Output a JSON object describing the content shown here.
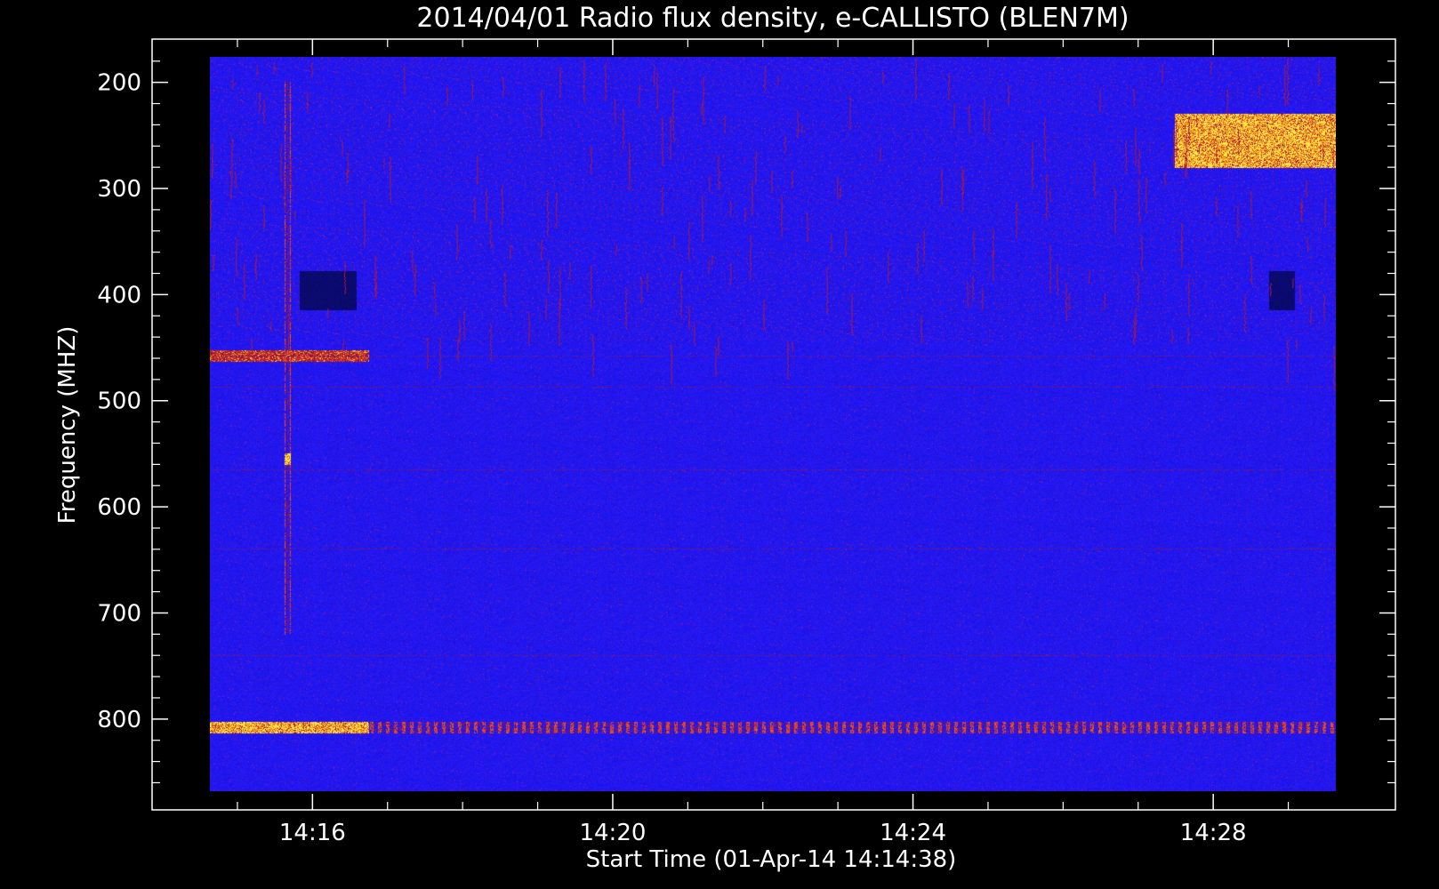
{
  "chart_data": {
    "type": "heatmap",
    "title": "2014/04/01  Radio flux density, e-CALLISTO (BLEN7M)",
    "xlabel": "Start Time (01-Apr-14 14:14:38)",
    "ylabel": "Frequency (MHZ)",
    "x_unit": "time of day (UTC)",
    "x_range": [
      "14:14:38",
      "14:29:38"
    ],
    "y_range": [
      176,
      868
    ],
    "y_inverted": true,
    "x_ticks": [
      "14:16",
      "14:20",
      "14:24",
      "14:28"
    ],
    "y_ticks": [
      200,
      300,
      400,
      500,
      600,
      700,
      800
    ],
    "colormap": "blue-red-yellow",
    "colors": {
      "background_level": "#1a1af0",
      "low_level": "#0a0a80",
      "medium_level": "#c01818",
      "high_level": "#ffe030",
      "frame": "#ffffff",
      "page_background": "#000000"
    },
    "features": [
      {
        "name": "strong emission band",
        "freq_mhz": 808,
        "time_start": "14:14:38",
        "time_end": "14:16:45",
        "level": "high"
      },
      {
        "name": "intermittent band",
        "freq_mhz": 808,
        "time_start": "14:16:45",
        "time_end": "14:29:38",
        "level": "medium"
      },
      {
        "name": "emission band",
        "freq_mhz": 458,
        "time_start": "14:14:38",
        "time_end": "14:16:45",
        "level": "medium-high"
      },
      {
        "name": "vertical burst",
        "freq_mhz_range": [
          200,
          720
        ],
        "time": "14:15:40",
        "level": "medium"
      },
      {
        "name": "bright spot",
        "freq_mhz": 555,
        "time": "14:15:40",
        "level": "high"
      },
      {
        "name": "burst cluster",
        "freq_mhz_range": [
          230,
          280
        ],
        "time_start": "14:27:30",
        "time_end": "14:29:38",
        "level": "high"
      },
      {
        "name": "dark gap",
        "freq_mhz_range": [
          378,
          414
        ],
        "time_start": "14:15:50",
        "time_end": "14:16:35",
        "level": "low"
      },
      {
        "name": "dark gap",
        "freq_mhz_range": [
          378,
          414
        ],
        "time_start": "14:28:45",
        "time_end": "14:29:05",
        "level": "low"
      }
    ]
  }
}
